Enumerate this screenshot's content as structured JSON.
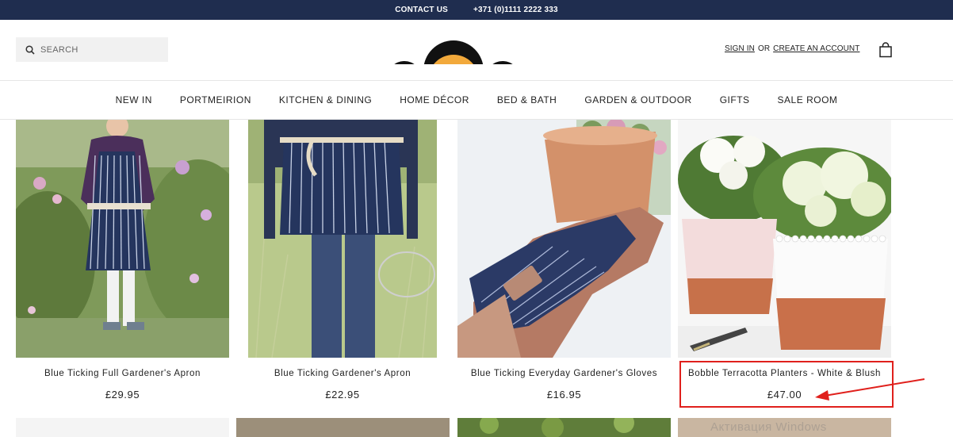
{
  "topbar": {
    "contact_label": "CONTACT US",
    "phone": "+371 (0)1111 2222 333"
  },
  "header": {
    "search_placeholder": "SEARCH",
    "sign_in_label": "SIGN IN",
    "or_label": "OR",
    "create_account_label": "CREATE AN ACCOUNT"
  },
  "nav": {
    "items": [
      {
        "label": "NEW IN"
      },
      {
        "label": "PORTMEIRION"
      },
      {
        "label": "KITCHEN & DINING"
      },
      {
        "label": "HOME DÉCOR"
      },
      {
        "label": "BED & BATH"
      },
      {
        "label": "GARDEN & OUTDOOR"
      },
      {
        "label": "GIFTS"
      },
      {
        "label": "SALE ROOM"
      }
    ]
  },
  "products": [
    {
      "name": "Blue Ticking Full Gardener's Apron",
      "price": "£29.95"
    },
    {
      "name": "Blue Ticking Gardener's Apron",
      "price": "£22.95"
    },
    {
      "name": "Blue Ticking Everyday Gardener's Gloves",
      "price": "£16.95"
    },
    {
      "name": "Bobble Terracotta Planters - White & Blush",
      "price": "£47.00"
    }
  ],
  "watermark": "Активация Windows",
  "colors": {
    "topbar_bg": "#1f2d4f",
    "logo_accent": "#f2a93b",
    "annotation_red": "#e0201c"
  }
}
